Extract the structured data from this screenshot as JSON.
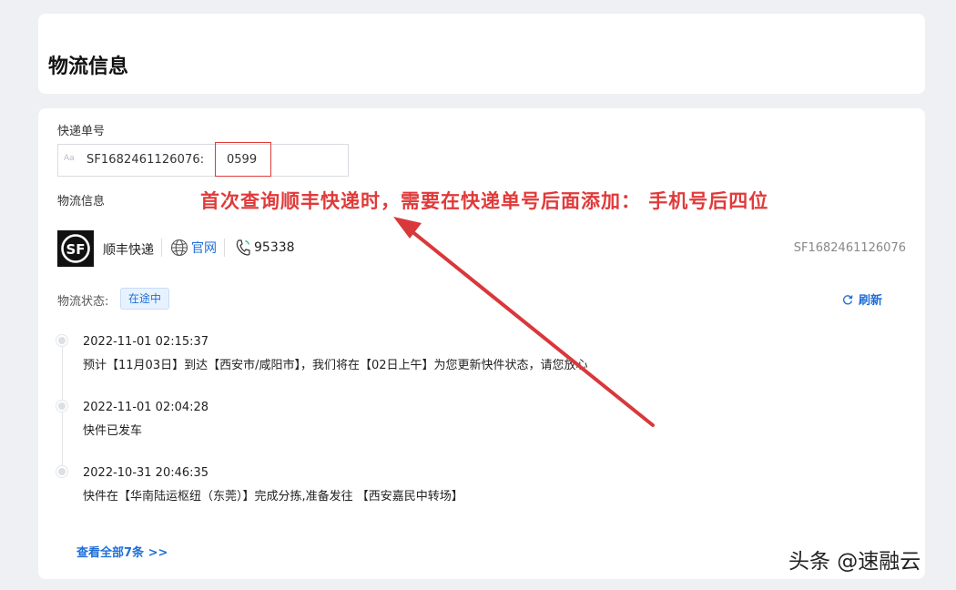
{
  "header": {
    "title": "物流信息"
  },
  "tracking_input": {
    "label": "快递单号",
    "type_hint": "Aa",
    "prefix": "SF1682461126076:",
    "suffix": "0599"
  },
  "logistics": {
    "section_label": "物流信息",
    "carrier_name": "顺丰快递",
    "site_label": "官网",
    "phone": "95338",
    "tracking_number": "SF1682461126076",
    "status_label": "物流状态:",
    "status_badge": "在途中",
    "refresh_label": "刷新"
  },
  "annotation": {
    "text": "首次查询顺丰快递时，需要在快递单号后面添加： 手机号后四位",
    "color": "#e03a3a"
  },
  "events": [
    {
      "time": "2022-11-01 02:15:37",
      "desc": "预计【11月03日】到达【西安市/咸阳市】，我们将在【02日上午】为您更新快件状态，请您放心"
    },
    {
      "time": "2022-11-01 02:04:28",
      "desc": "快件已发车"
    },
    {
      "time": "2022-10-31 20:46:35",
      "desc": "快件在【华南陆运枢纽（东莞）】完成分拣,准备发往 【西安嘉民中转场】"
    }
  ],
  "footer": {
    "view_all": "查看全部7条 >>"
  },
  "watermark": "头条 @速融云",
  "colors": {
    "accent": "#1f6fd6",
    "annotation": "#e03a3a",
    "background": "#eef0f4"
  },
  "icons": [
    "sf-logo-icon",
    "globe-icon",
    "phone-icon",
    "refresh-icon"
  ]
}
